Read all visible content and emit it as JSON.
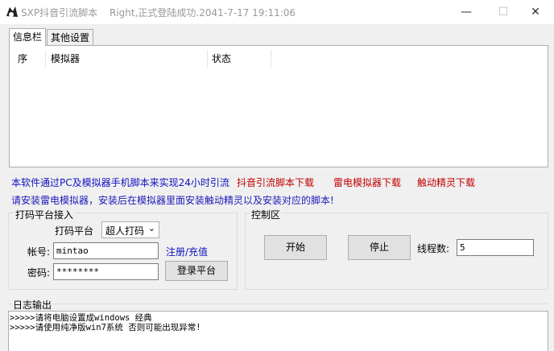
{
  "window": {
    "title": "SXP抖音引流脚本",
    "status": "Right,正式登陆成功.2041-7-17 19:11:06",
    "minimize_glyph": "—",
    "maximize_glyph": "☐",
    "close_glyph": "✕"
  },
  "tabs": [
    {
      "label": "信息栏",
      "active": true
    },
    {
      "label": "其他设置",
      "active": false
    }
  ],
  "table": {
    "columns": [
      "序",
      "模拟器",
      "状态"
    ],
    "rows": []
  },
  "links": {
    "intro": "本软件通过PC及模拟器手机脚本来实现24小时引流",
    "download_script": "抖音引流脚本下载",
    "download_emulator": "雷电模拟器下载",
    "download_touch": "触动精灵下载",
    "notice": "请安装雷电模拟器，安装后在模拟器里面安装触动精灵以及安装对应的脚本!"
  },
  "captcha_group": {
    "title": "打码平台接入",
    "platform_label": "打码平台",
    "platform_value": "超人打码",
    "account_label": "帐号:",
    "account_value": "mintao",
    "password_label": "密码:",
    "password_value": "********",
    "register_link": "注册/充值",
    "login_button": "登录平台"
  },
  "control_group": {
    "title": "控制区",
    "start_button": "开始",
    "stop_button": "停止",
    "threads_label": "线程数:",
    "threads_value": "5"
  },
  "log": {
    "title": "日志输出",
    "lines": [
      ">>>>>请将电脑设置成windows 经典",
      ">>>>>请使用纯净版win7系统 否则可能出现异常!"
    ]
  },
  "colors": {
    "blue_link": "#1010c0",
    "red_link": "#c00000",
    "notice_blue": "#1a1ab8"
  }
}
